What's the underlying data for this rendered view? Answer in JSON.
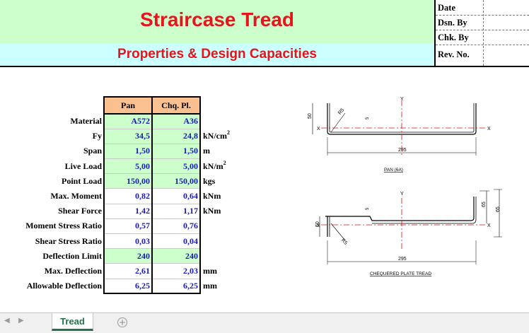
{
  "header": {
    "title": "Straircase Tread",
    "subtitle": "Properties & Design Capacities",
    "info_labels": [
      "Date",
      "Dsn. By",
      "Chk. By",
      "Rev. No."
    ]
  },
  "table": {
    "columns": [
      "Pan",
      "Chq. Pl."
    ],
    "rows": [
      {
        "label": "Material",
        "pan": "A572",
        "chq": "A36",
        "unit": ""
      },
      {
        "label": "Fy",
        "pan": "34,5",
        "chq": "24,8",
        "unit": "kN/cm",
        "sup": "2"
      },
      {
        "label": "Span",
        "pan": "1,50",
        "chq": "1,50",
        "unit": "m"
      },
      {
        "label": "Live Load",
        "pan": "5,00",
        "chq": "5,00",
        "unit": "kN/m",
        "sup": "2"
      },
      {
        "label": "Point Load",
        "pan": "150,00",
        "chq": "150,00",
        "unit": "kgs"
      },
      {
        "label": "Max. Moment",
        "pan": "0,82",
        "chq": "0,64",
        "unit": "kNm"
      },
      {
        "label": "Shear Force",
        "pan": "1,42",
        "chq": "1,17",
        "unit": "kNm"
      },
      {
        "label": "Moment Stress Ratio",
        "pan": "0,57",
        "chq": "0,76",
        "unit": ""
      },
      {
        "label": "Shear Stress Ratio",
        "pan": "0,03",
        "chq": "0,04",
        "unit": ""
      },
      {
        "label": "Deflection Limit",
        "pan": "240",
        "chq": "240",
        "unit": ""
      },
      {
        "label": "Max. Deflection",
        "pan": "2,61",
        "chq": "2,03",
        "unit": "mm"
      },
      {
        "label": "Allowable Deflection",
        "pan": "6,25",
        "chq": "6,25",
        "unit": "mm"
      }
    ]
  },
  "drawings": {
    "pan": {
      "caption": "PAN (6A)",
      "width_dim": "295",
      "height_dim": "50",
      "radius_label": "R5",
      "axis_x": "X",
      "axis_y": "Y"
    },
    "plate": {
      "caption": "CHEQUERED PLATE TREAD",
      "width_dim": "295",
      "height_dim_outer": "65",
      "height_dim_inner": "50",
      "height_dim_right": "65",
      "radius_label": "R5",
      "axis_x": "X",
      "axis_y": "Y"
    }
  },
  "sheet_tabs": [
    "Tread"
  ],
  "colors": {
    "title": "#e8141b",
    "value": "#1a1ab5",
    "title_band": "#ccffcc",
    "subtitle_band": "#ccffff",
    "header_fill": "#fac090",
    "input_fill": "#ccffcc",
    "tab_active": "#217346"
  }
}
